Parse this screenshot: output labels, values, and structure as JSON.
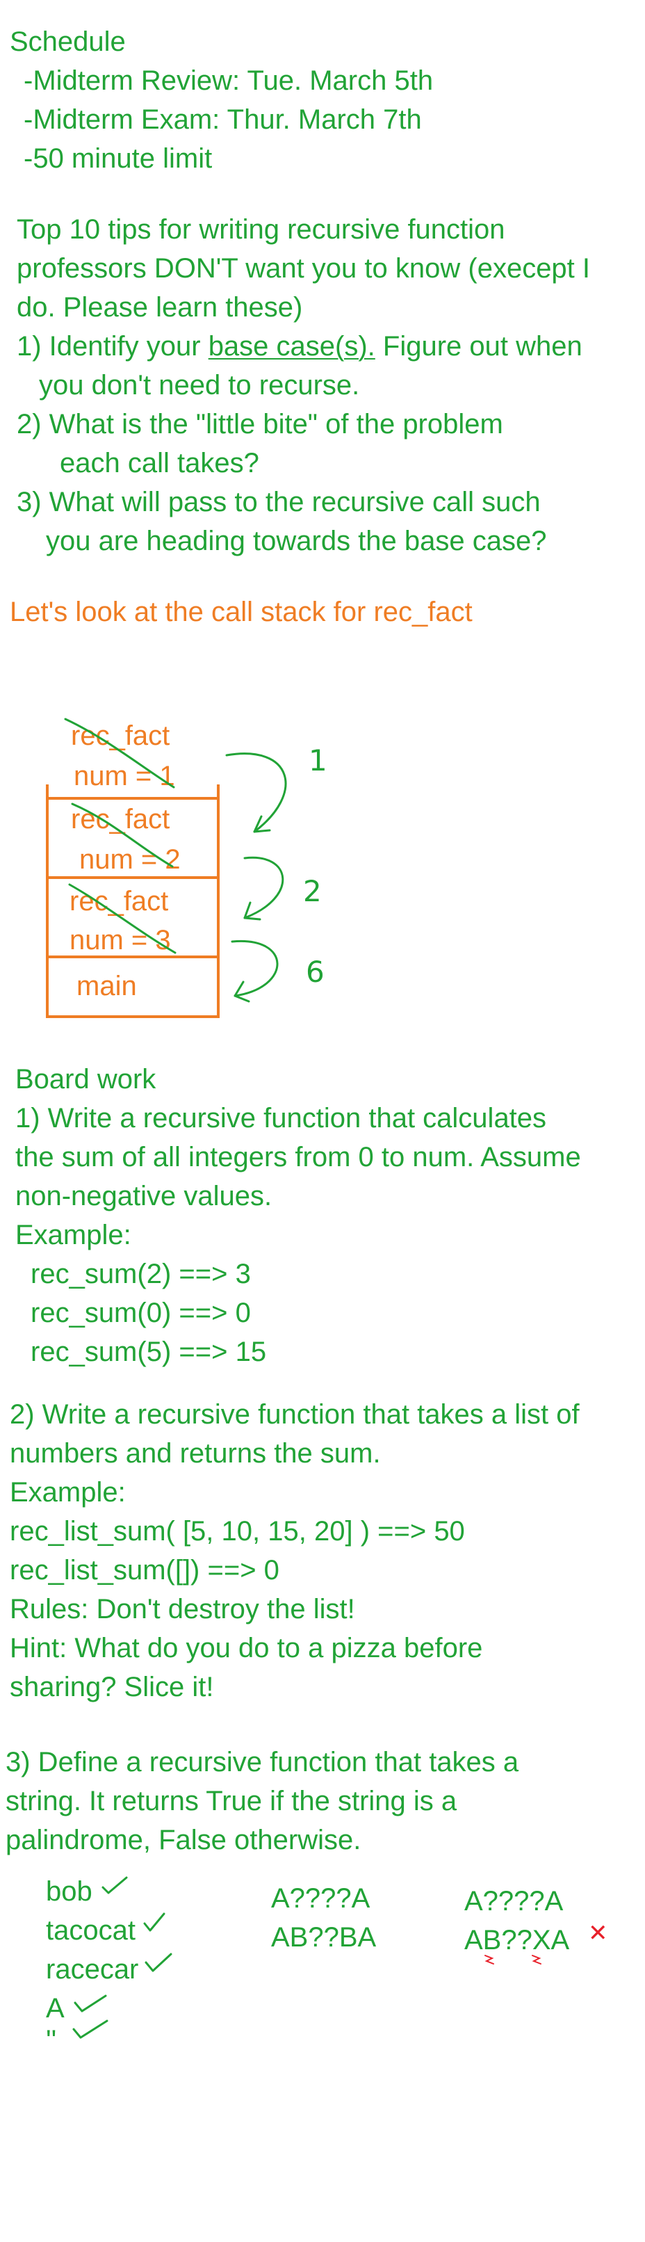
{
  "schedule": {
    "title": "Schedule",
    "lines": [
      "-Midterm Review: Tue. March 5th",
      "-Midterm Exam: Thur. March 7th",
      "-50 minute limit"
    ]
  },
  "tips": {
    "intro": [
      "Top 10 tips for writing recursive function",
      "professors DON'T want you to know (execept I",
      "do. Please learn these)"
    ],
    "tip1_prefix": "1) Identify your ",
    "tip1_underlined": "base case(s).",
    "tip1_suffix": " Figure out when",
    "tip1_cont": "you don't need to recurse.",
    "tip2": [
      "2) What is the \"little bite\" of the problem",
      "each call takes?"
    ],
    "tip3": [
      "3) What will pass to the recursive call such",
      "you are heading towards the base case?"
    ]
  },
  "callstack": {
    "heading": "Let's look at the call stack for rec_fact",
    "frames": [
      {
        "name": "rec_fact",
        "var": "num = 1"
      },
      {
        "name": "rec_fact",
        "var": "num = 2"
      },
      {
        "name": "rec_fact",
        "var": "num = 3"
      },
      {
        "name": "main"
      }
    ],
    "returns": [
      "1",
      "2",
      "6"
    ]
  },
  "boardwork": {
    "title": "Board work",
    "p1": {
      "lines": [
        "1) Write a recursive function that calculates",
        "the sum of all integers from 0 to num. Assume",
        "non-negative values."
      ],
      "example_label": "Example:",
      "examples": [
        "rec_sum(2) ==> 3",
        "rec_sum(0) ==> 0",
        "rec_sum(5) ==> 15"
      ]
    },
    "p2": {
      "lines": [
        "2) Write a recursive function that takes a list of",
        "numbers and returns the sum."
      ],
      "example_label": "Example:",
      "examples": [
        "rec_list_sum( [5, 10, 15, 20] ) ==> 50",
        "rec_list_sum([]) ==> 0"
      ],
      "rules": "Rules: Don't destroy the list!",
      "hint": [
        "Hint: What do you do to a pizza before",
        "sharing? Slice it!"
      ]
    },
    "p3": {
      "lines": [
        "3) Define a recursive function that takes a",
        "string. It returns True if the string is a",
        "palindrome, False otherwise."
      ],
      "words": [
        "bob",
        "tacocat",
        "racecar",
        "A",
        "''"
      ],
      "pattern_a": [
        "A????A",
        "AB??BA"
      ],
      "pattern_b": [
        "A????A",
        "AB??XA"
      ],
      "mismatch_mark": "✕"
    }
  },
  "colors": {
    "green": "#21a336",
    "orange": "#ef7d24",
    "red": "#e8202a"
  }
}
